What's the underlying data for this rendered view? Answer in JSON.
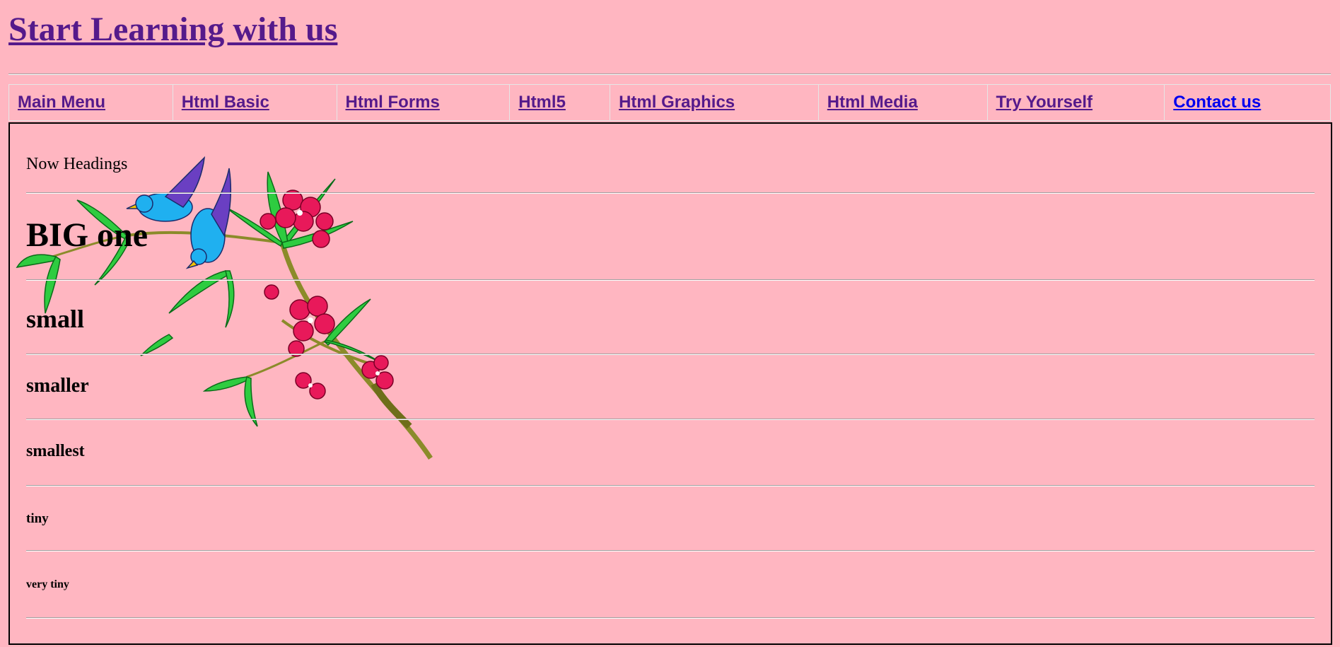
{
  "header": {
    "title": "Start Learning with us"
  },
  "nav": {
    "items": [
      {
        "label": "Main Menu"
      },
      {
        "label": "Html Basic"
      },
      {
        "label": "Html Forms"
      },
      {
        "label": "Html5"
      },
      {
        "label": "Html Graphics"
      },
      {
        "label": "Html Media"
      },
      {
        "label": "Try Yourself"
      },
      {
        "label": "Contact us"
      }
    ]
  },
  "content": {
    "intro": "Now Headings",
    "headings": {
      "h1": "BIG one",
      "h2": "small",
      "h3": "smaller",
      "h4": "smallest",
      "h5": "tiny",
      "h6": "very tiny"
    },
    "decoration": "bird-and-blossom-image"
  },
  "colors": {
    "background": "#ffb6c1",
    "visited_link": "#551a8b",
    "link": "#0000ee"
  }
}
